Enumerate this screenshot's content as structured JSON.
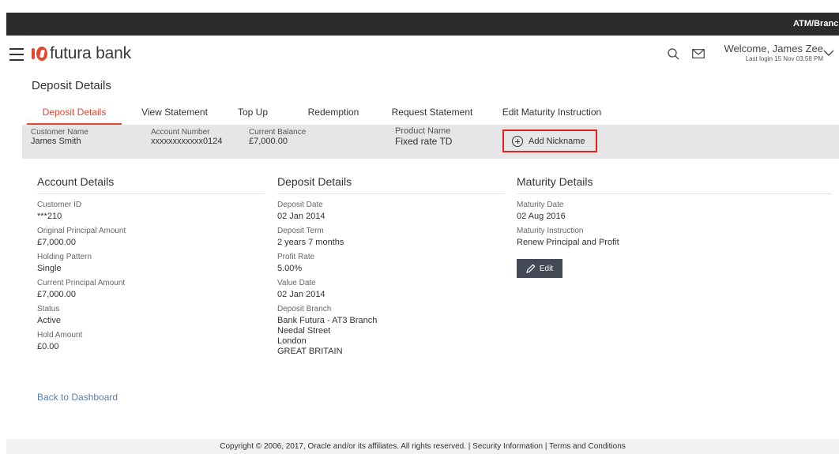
{
  "topbar": {
    "right_text": "ATM/Branch"
  },
  "header": {
    "brand": "futura bank",
    "welcome": "Welcome, James Zee",
    "last_login": "Last login 15 Nov 03:58 PM"
  },
  "page": {
    "title": "Deposit Details"
  },
  "tabs": [
    {
      "label": "Deposit Details",
      "active": true
    },
    {
      "label": "View Statement",
      "active": false
    },
    {
      "label": "Top Up",
      "active": false
    },
    {
      "label": "Redemption",
      "active": false
    },
    {
      "label": "Request Statement",
      "active": false
    },
    {
      "label": "Edit Maturity Instruction",
      "active": false
    }
  ],
  "summary": {
    "customer_name_label": "Customer Name",
    "customer_name": "James Smith",
    "account_number_label": "Account Number",
    "account_number": "xxxxxxxxxxxx0124",
    "current_balance_label": "Current Balance",
    "current_balance": "£7,000.00",
    "product_name_label": "Product Name",
    "product_name": "Fixed rate TD",
    "add_nickname": "Add Nickname"
  },
  "account_details": {
    "title": "Account Details",
    "fields": [
      {
        "label": "Customer ID",
        "value": "***210"
      },
      {
        "label": "Original Principal Amount",
        "value": "£7,000.00"
      },
      {
        "label": "Holding Pattern",
        "value": "Single"
      },
      {
        "label": "Current Principal Amount",
        "value": "£7,000.00"
      },
      {
        "label": "Status",
        "value": "Active"
      },
      {
        "label": "Hold Amount",
        "value": "£0.00"
      }
    ]
  },
  "deposit_details": {
    "title": "Deposit Details",
    "fields": [
      {
        "label": "Deposit Date",
        "value": "02 Jan 2014"
      },
      {
        "label": "Deposit Term",
        "value": "2 years 7 months"
      },
      {
        "label": "Profit Rate",
        "value": "5.00%"
      },
      {
        "label": "Value Date",
        "value": "02 Jan 2014"
      },
      {
        "label": "Deposit Branch",
        "lines": [
          "Bank Futura - AT3 Branch",
          "Needal Street",
          "London",
          "GREAT BRITAIN"
        ]
      }
    ]
  },
  "maturity_details": {
    "title": "Maturity Details",
    "fields": [
      {
        "label": "Maturity Date",
        "value": "02 Aug 2016"
      },
      {
        "label": "Maturity Instruction",
        "value": "Renew Principal and Profit"
      }
    ],
    "edit_label": "Edit"
  },
  "back_link": "Back to Dashboard",
  "footer": "Copyright © 2006, 2017, Oracle and/or its affiliates. All rights reserved. | Security Information | Terms and Conditions",
  "colors": {
    "accent": "#e2462e",
    "highlight_box": "#e42222",
    "topbar": "#2b2b2b",
    "link": "#5a7db0"
  },
  "icons": [
    "hamburger-icon",
    "logo-icon",
    "search-icon",
    "mail-icon",
    "chevron-down-icon",
    "add-circle-icon",
    "pencil-icon"
  ]
}
